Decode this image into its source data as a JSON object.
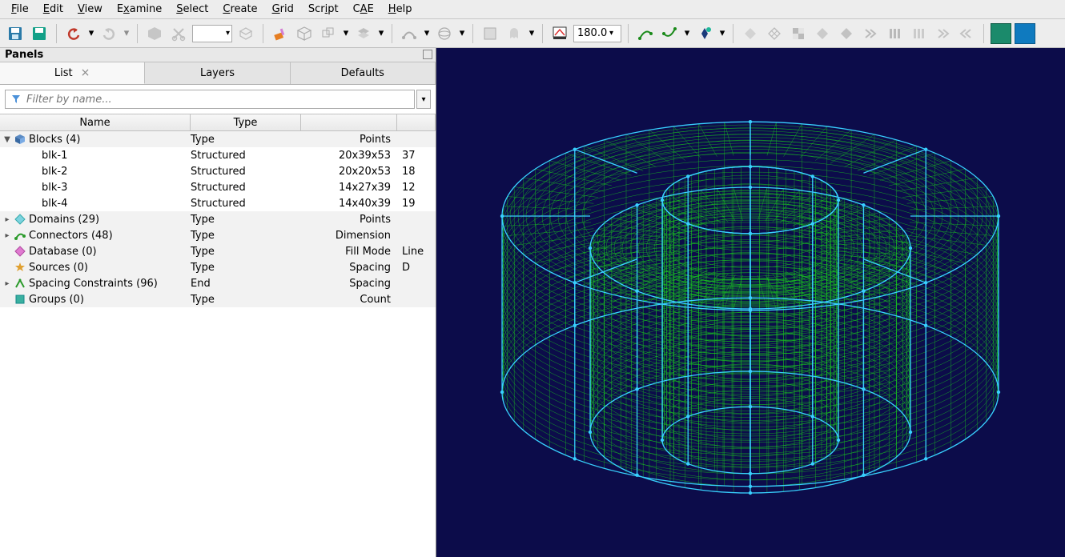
{
  "menu": {
    "items": [
      "File",
      "Edit",
      "View",
      "Examine",
      "Select",
      "Create",
      "Grid",
      "Script",
      "CAE",
      "Help"
    ],
    "mnemonics": [
      "F",
      "E",
      "V",
      "x",
      "S",
      "C",
      "G",
      "i",
      "A",
      "H"
    ]
  },
  "toolbar": {
    "angle_value": "180.0",
    "icons": [
      "save-icon",
      "save-as-icon",
      "undo-icon",
      "undo-dd-icon",
      "redo-icon",
      "redo-dd-icon",
      "cube-fill-icon",
      "scissors-icon",
      "combo-dd",
      "rotate-cube-icon",
      "paint-icon",
      "wire-cube-icon",
      "multi-cube-icon",
      "layers-rhombus-icon",
      "spline-icon",
      "sphere-plus-icon",
      "grid-sq-icon",
      "ghost-icon",
      "angle-indicator-icon",
      "curve-a-icon",
      "curve-b-icon",
      "marker-icon",
      "rhombus-a-icon",
      "rhombus-b-icon",
      "checker-icon",
      "rhombus-c-icon",
      "rhombus-d-icon",
      "chevrons-a-icon",
      "bars-a-icon",
      "bars-b-icon",
      "chevrons-b-icon",
      "chevrons-c-icon",
      "grid-mode-a-icon",
      "grid-mode-b-icon"
    ]
  },
  "panel": {
    "title": "Panels",
    "tabs": [
      "List",
      "Layers",
      "Defaults"
    ],
    "active_tab": 0,
    "filter_placeholder": "Filter by name...",
    "columns": [
      "Name",
      "Type",
      "",
      ""
    ],
    "tree": [
      {
        "expanded": true,
        "icon": "cube-blue",
        "name": "Blocks (4)",
        "type": "Type",
        "extra": "Points",
        "last": ""
      },
      {
        "child": true,
        "name": "blk-1",
        "type": "Structured",
        "extra": "20x39x53",
        "last": "37"
      },
      {
        "child": true,
        "name": "blk-2",
        "type": "Structured",
        "extra": "20x20x53",
        "last": "18"
      },
      {
        "child": true,
        "name": "blk-3",
        "type": "Structured",
        "extra": "14x27x39",
        "last": "12"
      },
      {
        "child": true,
        "name": "blk-4",
        "type": "Structured",
        "extra": "14x40x39",
        "last": "19"
      },
      {
        "expandable": true,
        "icon": "diamond-cyan",
        "name": "Domains (29)",
        "type": "Type",
        "extra": "Points",
        "last": ""
      },
      {
        "expandable": true,
        "icon": "connector-green",
        "name": "Connectors (48)",
        "type": "Type",
        "extra": "Dimension",
        "last": ""
      },
      {
        "icon": "diamond-pink",
        "name": "Database (0)",
        "type": "Type",
        "extra": "Fill Mode",
        "last": "Line"
      },
      {
        "icon": "star-gold",
        "name": "Sources (0)",
        "type": "Type",
        "extra": "Spacing",
        "last": "D"
      },
      {
        "expandable": true,
        "icon": "constraint-green",
        "name": "Spacing Constraints (96)",
        "type": "End",
        "extra": "Spacing",
        "last": ""
      },
      {
        "icon": "square-teal",
        "name": "Groups (0)",
        "type": "Type",
        "extra": "Count",
        "last": ""
      }
    ]
  },
  "colors": {
    "viewport_bg": "#0c0c4a",
    "mesh_green": "#1bd81b",
    "edge_cyan": "#38d0ff"
  }
}
